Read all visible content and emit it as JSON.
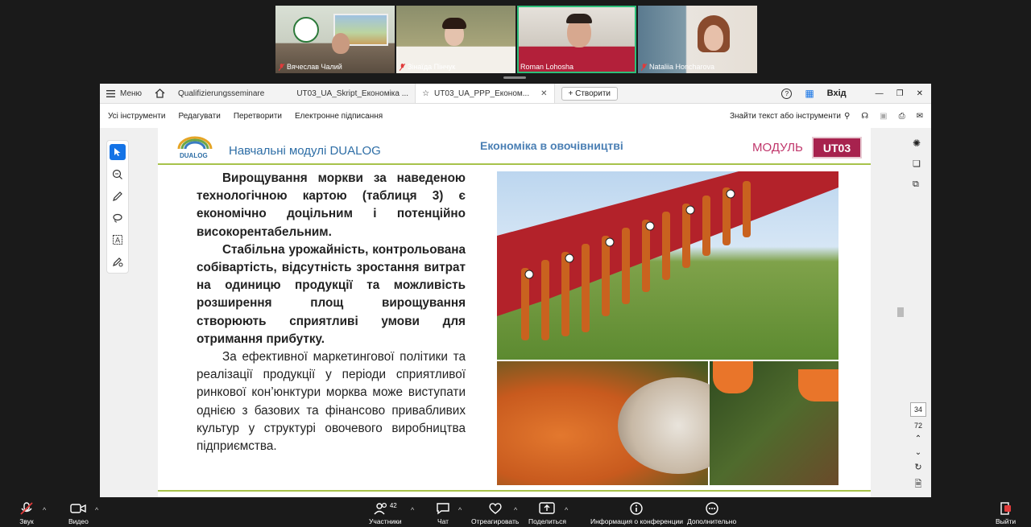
{
  "participants": [
    {
      "name": "Вячеслав Чалий",
      "muted": true
    },
    {
      "name": "Зінаїда Пінчук",
      "muted": true
    },
    {
      "name": "Roman Lohosha",
      "muted": false,
      "active": true
    },
    {
      "name": "Nataliia Honcharova",
      "muted": true
    }
  ],
  "acrobat": {
    "menu_label": "Меню",
    "tabs": [
      {
        "label": "Qualifizierungsseminare"
      },
      {
        "label": "UT03_UA_Skript_Економіка ..."
      },
      {
        "label": "UT03_UA_PPP_Економ..."
      }
    ],
    "create_label": "+ Створити",
    "login_label": "Вхід",
    "toolbar": {
      "all_tools": "Усі інструменти",
      "edit": "Редагувати",
      "convert": "Перетворити",
      "esign": "Електронне підписання",
      "search_label": "Знайти текст або інструменти"
    },
    "page_current": "34",
    "page_total": "72"
  },
  "slide": {
    "header_left": "Навчальні модулі  DUALOG",
    "header_center": "Економіка в овочівництві",
    "modul_label": "МОДУЛЬ",
    "modul_code": "UT03",
    "logo_text": "DUALOG",
    "para1": "Вирощування моркви за наведеною технологічною картою (таблиця 3) є економічно доцільним і потенційно високорентабельним.",
    "para2": "Стабільна урожайність, контрольована собівартість, відсутність зростання витрат на одиницю продукції та можливість розширення площ вирощування створюють сприятливі умови для отримання прибутку.",
    "para3": "За ефективної маркетингової політики та реалізації продукції у періоди сприятливої ринкової кон’юнктури морква може виступати однією з базових та фінансово привабливих культур у структурі овочевого виробництва підприємства."
  },
  "zoom_bar": {
    "sound": "Звук",
    "video": "Видео",
    "participants": "Участники",
    "participants_count": "42",
    "chat": "Чат",
    "react": "Отреагировать",
    "share": "Поделиться",
    "info": "Информация о конференции",
    "more": "Дополнительно",
    "leave": "Выйти"
  },
  "colors": {
    "accent_green": "#a7c24a",
    "modul_red": "#a7224e",
    "title_blue": "#2e6ea6",
    "active_speaker": "#2dbf7a"
  }
}
